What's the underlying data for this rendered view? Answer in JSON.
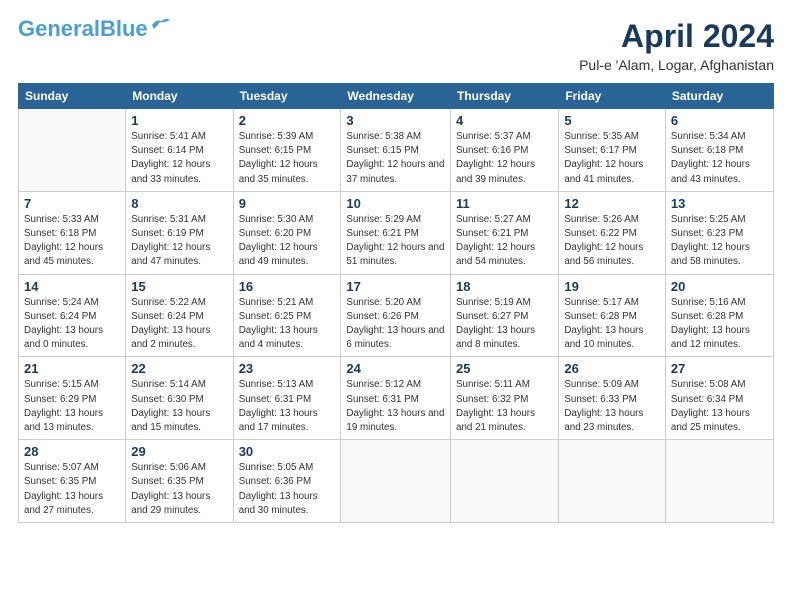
{
  "header": {
    "logo_general": "General",
    "logo_blue": "Blue",
    "month_title": "April 2024",
    "location": "Pul-e 'Alam, Logar, Afghanistan"
  },
  "weekdays": [
    "Sunday",
    "Monday",
    "Tuesday",
    "Wednesday",
    "Thursday",
    "Friday",
    "Saturday"
  ],
  "weeks": [
    [
      {
        "day": "",
        "empty": true
      },
      {
        "day": "1",
        "sunrise": "Sunrise: 5:41 AM",
        "sunset": "Sunset: 6:14 PM",
        "daylight": "Daylight: 12 hours and 33 minutes."
      },
      {
        "day": "2",
        "sunrise": "Sunrise: 5:39 AM",
        "sunset": "Sunset: 6:15 PM",
        "daylight": "Daylight: 12 hours and 35 minutes."
      },
      {
        "day": "3",
        "sunrise": "Sunrise: 5:38 AM",
        "sunset": "Sunset: 6:15 PM",
        "daylight": "Daylight: 12 hours and 37 minutes."
      },
      {
        "day": "4",
        "sunrise": "Sunrise: 5:37 AM",
        "sunset": "Sunset: 6:16 PM",
        "daylight": "Daylight: 12 hours and 39 minutes."
      },
      {
        "day": "5",
        "sunrise": "Sunrise: 5:35 AM",
        "sunset": "Sunset: 6:17 PM",
        "daylight": "Daylight: 12 hours and 41 minutes."
      },
      {
        "day": "6",
        "sunrise": "Sunrise: 5:34 AM",
        "sunset": "Sunset: 6:18 PM",
        "daylight": "Daylight: 12 hours and 43 minutes."
      }
    ],
    [
      {
        "day": "7",
        "sunrise": "Sunrise: 5:33 AM",
        "sunset": "Sunset: 6:18 PM",
        "daylight": "Daylight: 12 hours and 45 minutes."
      },
      {
        "day": "8",
        "sunrise": "Sunrise: 5:31 AM",
        "sunset": "Sunset: 6:19 PM",
        "daylight": "Daylight: 12 hours and 47 minutes."
      },
      {
        "day": "9",
        "sunrise": "Sunrise: 5:30 AM",
        "sunset": "Sunset: 6:20 PM",
        "daylight": "Daylight: 12 hours and 49 minutes."
      },
      {
        "day": "10",
        "sunrise": "Sunrise: 5:29 AM",
        "sunset": "Sunset: 6:21 PM",
        "daylight": "Daylight: 12 hours and 51 minutes."
      },
      {
        "day": "11",
        "sunrise": "Sunrise: 5:27 AM",
        "sunset": "Sunset: 6:21 PM",
        "daylight": "Daylight: 12 hours and 54 minutes."
      },
      {
        "day": "12",
        "sunrise": "Sunrise: 5:26 AM",
        "sunset": "Sunset: 6:22 PM",
        "daylight": "Daylight: 12 hours and 56 minutes."
      },
      {
        "day": "13",
        "sunrise": "Sunrise: 5:25 AM",
        "sunset": "Sunset: 6:23 PM",
        "daylight": "Daylight: 12 hours and 58 minutes."
      }
    ],
    [
      {
        "day": "14",
        "sunrise": "Sunrise: 5:24 AM",
        "sunset": "Sunset: 6:24 PM",
        "daylight": "Daylight: 13 hours and 0 minutes."
      },
      {
        "day": "15",
        "sunrise": "Sunrise: 5:22 AM",
        "sunset": "Sunset: 6:24 PM",
        "daylight": "Daylight: 13 hours and 2 minutes."
      },
      {
        "day": "16",
        "sunrise": "Sunrise: 5:21 AM",
        "sunset": "Sunset: 6:25 PM",
        "daylight": "Daylight: 13 hours and 4 minutes."
      },
      {
        "day": "17",
        "sunrise": "Sunrise: 5:20 AM",
        "sunset": "Sunset: 6:26 PM",
        "daylight": "Daylight: 13 hours and 6 minutes."
      },
      {
        "day": "18",
        "sunrise": "Sunrise: 5:19 AM",
        "sunset": "Sunset: 6:27 PM",
        "daylight": "Daylight: 13 hours and 8 minutes."
      },
      {
        "day": "19",
        "sunrise": "Sunrise: 5:17 AM",
        "sunset": "Sunset: 6:28 PM",
        "daylight": "Daylight: 13 hours and 10 minutes."
      },
      {
        "day": "20",
        "sunrise": "Sunrise: 5:16 AM",
        "sunset": "Sunset: 6:28 PM",
        "daylight": "Daylight: 13 hours and 12 minutes."
      }
    ],
    [
      {
        "day": "21",
        "sunrise": "Sunrise: 5:15 AM",
        "sunset": "Sunset: 6:29 PM",
        "daylight": "Daylight: 13 hours and 13 minutes."
      },
      {
        "day": "22",
        "sunrise": "Sunrise: 5:14 AM",
        "sunset": "Sunset: 6:30 PM",
        "daylight": "Daylight: 13 hours and 15 minutes."
      },
      {
        "day": "23",
        "sunrise": "Sunrise: 5:13 AM",
        "sunset": "Sunset: 6:31 PM",
        "daylight": "Daylight: 13 hours and 17 minutes."
      },
      {
        "day": "24",
        "sunrise": "Sunrise: 5:12 AM",
        "sunset": "Sunset: 6:31 PM",
        "daylight": "Daylight: 13 hours and 19 minutes."
      },
      {
        "day": "25",
        "sunrise": "Sunrise: 5:11 AM",
        "sunset": "Sunset: 6:32 PM",
        "daylight": "Daylight: 13 hours and 21 minutes."
      },
      {
        "day": "26",
        "sunrise": "Sunrise: 5:09 AM",
        "sunset": "Sunset: 6:33 PM",
        "daylight": "Daylight: 13 hours and 23 minutes."
      },
      {
        "day": "27",
        "sunrise": "Sunrise: 5:08 AM",
        "sunset": "Sunset: 6:34 PM",
        "daylight": "Daylight: 13 hours and 25 minutes."
      }
    ],
    [
      {
        "day": "28",
        "sunrise": "Sunrise: 5:07 AM",
        "sunset": "Sunset: 6:35 PM",
        "daylight": "Daylight: 13 hours and 27 minutes."
      },
      {
        "day": "29",
        "sunrise": "Sunrise: 5:06 AM",
        "sunset": "Sunset: 6:35 PM",
        "daylight": "Daylight: 13 hours and 29 minutes."
      },
      {
        "day": "30",
        "sunrise": "Sunrise: 5:05 AM",
        "sunset": "Sunset: 6:36 PM",
        "daylight": "Daylight: 13 hours and 30 minutes."
      },
      {
        "day": "",
        "empty": true
      },
      {
        "day": "",
        "empty": true
      },
      {
        "day": "",
        "empty": true
      },
      {
        "day": "",
        "empty": true
      }
    ]
  ]
}
